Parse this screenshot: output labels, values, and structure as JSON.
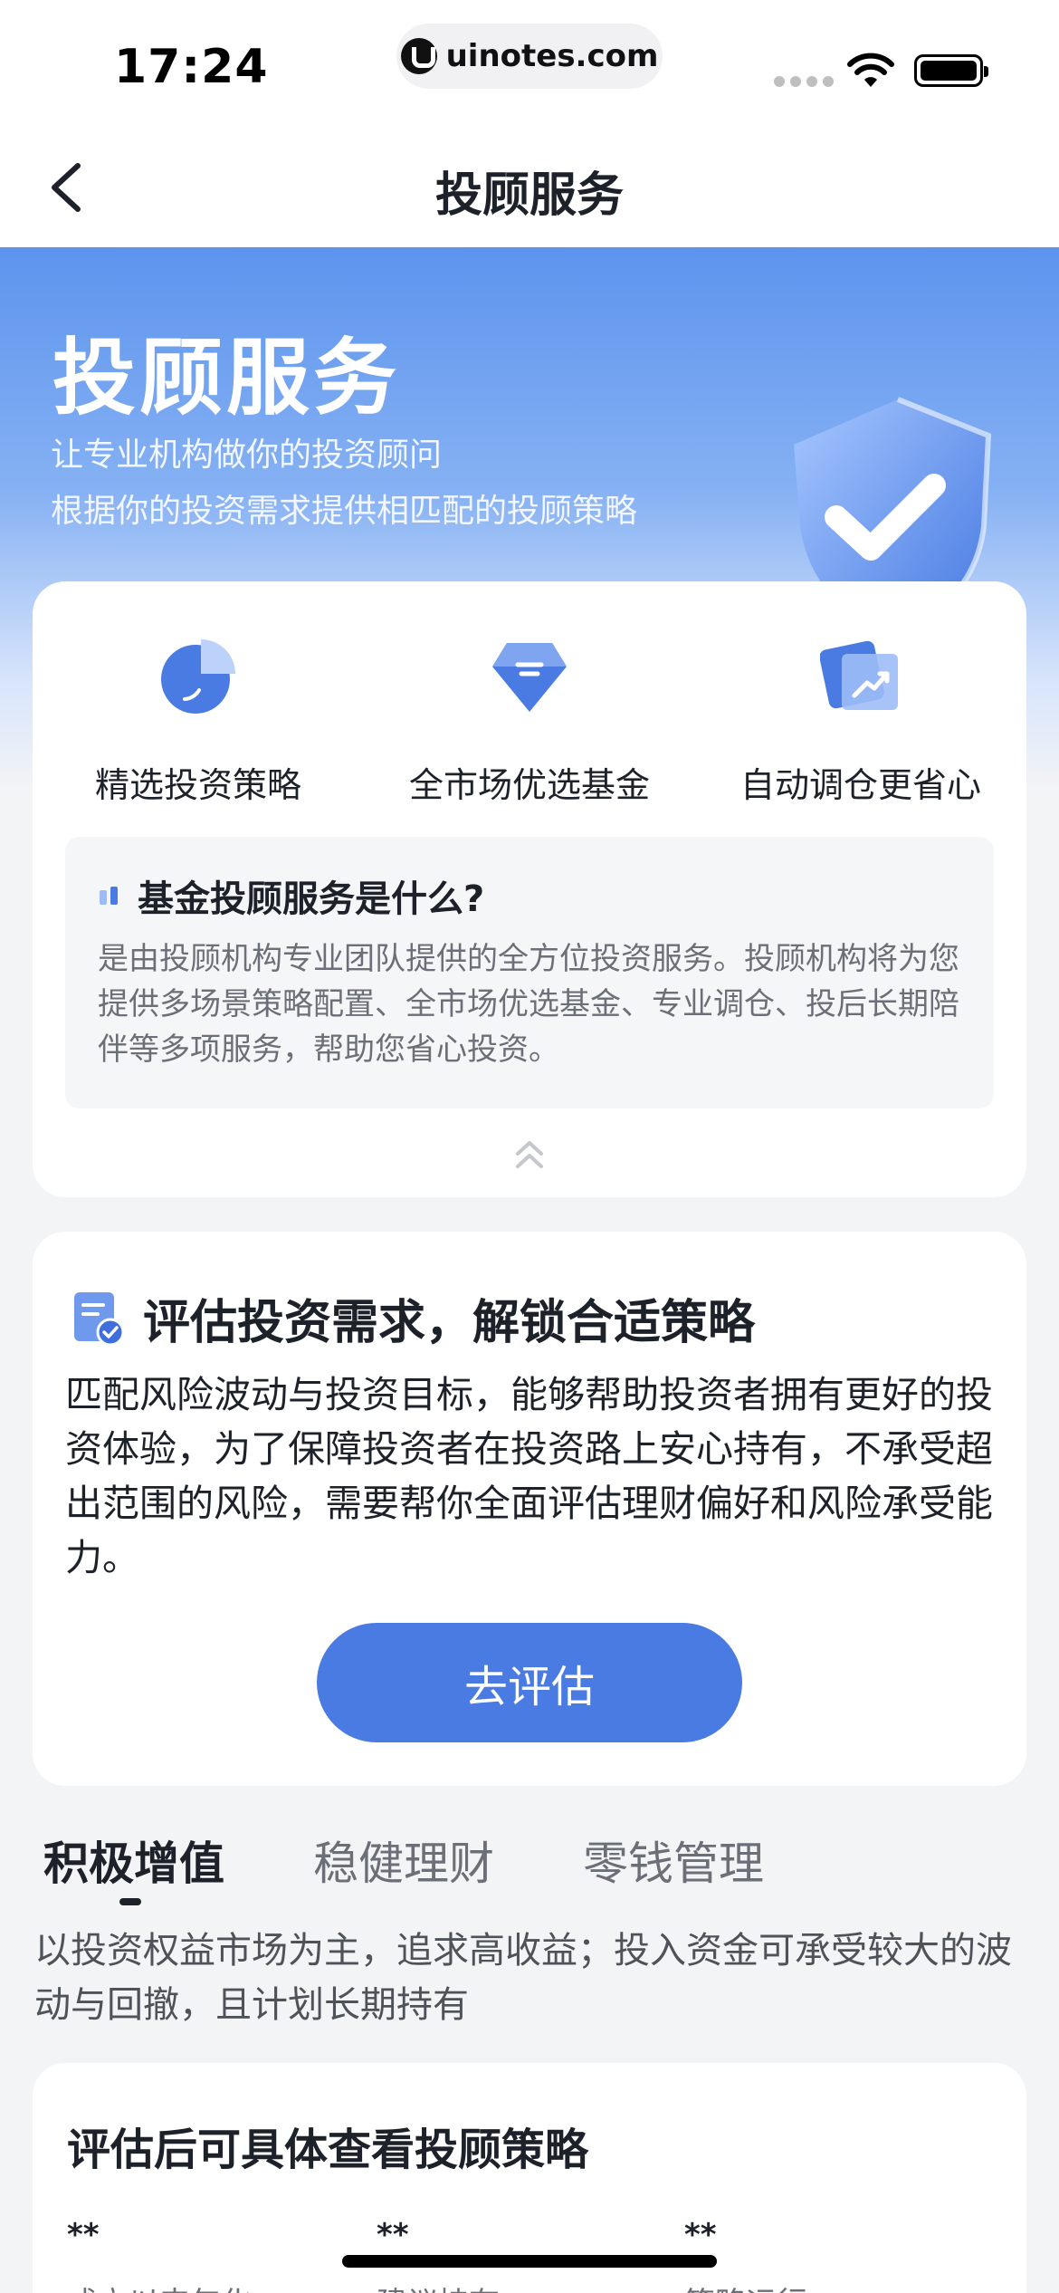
{
  "status_bar": {
    "time": "17:24",
    "url": "uinotes.com"
  },
  "nav": {
    "title": "投顾服务"
  },
  "hero": {
    "title": "投顾服务",
    "subtitle_1": "让专业机构做你的投资顾问",
    "subtitle_2": "根据你的投资需求提供相匹配的投顾策略"
  },
  "features": [
    {
      "icon": "pie-chart-icon",
      "label": "精选投资策略"
    },
    {
      "icon": "diamond-icon",
      "label": "全市场优选基金"
    },
    {
      "icon": "trend-card-icon",
      "label": "自动调仓更省心"
    }
  ],
  "info": {
    "title": "基金投顾服务是什么?",
    "text": "是由投顾机构专业团队提供的全方位投资服务。投顾机构将为您提供多场景策略配置、全市场优选基金、专业调仓、投后长期陪伴等多项服务，帮助您省心投资。"
  },
  "assessment": {
    "title": "评估投资需求，解锁合适策略",
    "body": "匹配风险波动与投资目标，能够帮助投资者拥有更好的投资体验，为了保障投资者在投资路上安心持有，不承受超出范围的风险，需要帮你全面评估理财偏好和风险承受能力。",
    "button": "去评估"
  },
  "tabs": [
    {
      "label": "积极增值",
      "active": true
    },
    {
      "label": "稳健理财",
      "active": false
    },
    {
      "label": "零钱管理",
      "active": false
    }
  ],
  "tab_description": "以投资权益市场为主，追求高收益；投入资金可承受较大的波动与回撤，且计划长期持有",
  "strategy": {
    "title": "评估后可具体查看投顾策略",
    "stats": [
      {
        "value": "**",
        "label": "成立以来年化"
      },
      {
        "value": "**",
        "label": "建议持有"
      },
      {
        "value": "**",
        "label": "策略运行"
      }
    ]
  },
  "colors": {
    "primary": "#4a7be2",
    "hero_top": "#5d94ee",
    "text": "#1d2129",
    "muted": "#6b6f77"
  }
}
